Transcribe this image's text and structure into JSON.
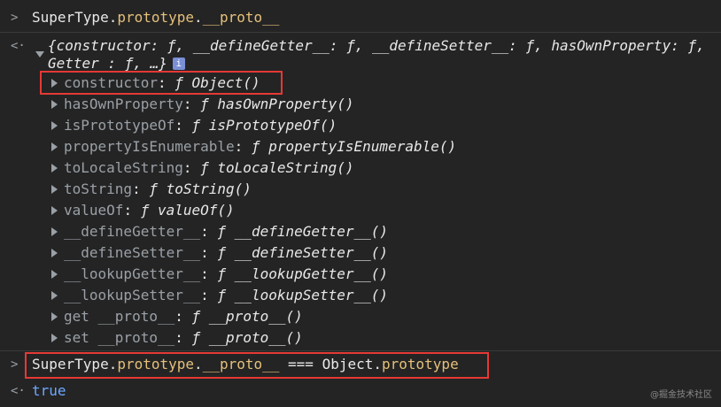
{
  "console": {
    "command1": {
      "obj": "SuperType",
      "dot1": ".",
      "prop1": "prototype",
      "dot2": ".",
      "prop2": "__proto__"
    },
    "result_summary_line1": "{constructor: ƒ, __defineGetter__: ƒ, __defineSetter__: ƒ, hasOwnProperty: ƒ,",
    "result_summary_line2": "Getter  : ƒ, …}",
    "info_badge": "i",
    "properties": [
      {
        "key": "constructor",
        "sep": ": ",
        "f": "ƒ",
        "fn": "Object()"
      },
      {
        "key": "hasOwnProperty",
        "sep": ": ",
        "f": "ƒ",
        "fn": "hasOwnProperty()"
      },
      {
        "key": "isPrototypeOf",
        "sep": ": ",
        "f": "ƒ",
        "fn": "isPrototypeOf()"
      },
      {
        "key": "propertyIsEnumerable",
        "sep": ": ",
        "f": "ƒ",
        "fn": "propertyIsEnumerable()"
      },
      {
        "key": "toLocaleString",
        "sep": ": ",
        "f": "ƒ",
        "fn": "toLocaleString()"
      },
      {
        "key": "toString",
        "sep": ": ",
        "f": "ƒ",
        "fn": "toString()"
      },
      {
        "key": "valueOf",
        "sep": ": ",
        "f": "ƒ",
        "fn": "valueOf()"
      },
      {
        "key": "__defineGetter__",
        "sep": ": ",
        "f": "ƒ",
        "fn": "__defineGetter__()"
      },
      {
        "key": "__defineSetter__",
        "sep": ": ",
        "f": "ƒ",
        "fn": "__defineSetter__()"
      },
      {
        "key": "__lookupGetter__",
        "sep": ": ",
        "f": "ƒ",
        "fn": "__lookupGetter__()"
      },
      {
        "key": "__lookupSetter__",
        "sep": ": ",
        "f": "ƒ",
        "fn": "__lookupSetter__()"
      },
      {
        "key": "get __proto__",
        "sep": ": ",
        "f": "ƒ",
        "fn": "__proto__()"
      },
      {
        "key": "set __proto__",
        "sep": ": ",
        "f": "ƒ",
        "fn": "__proto__()"
      }
    ],
    "command2": {
      "obj": "SuperType",
      "dot1": ".",
      "prop1": "prototype",
      "dot2": ".",
      "prop2": "__proto__",
      "op": " === ",
      "obj2": "Object",
      "dot3": ".",
      "prop3": "prototype"
    },
    "result2": "true",
    "prompt_symbol": ">",
    "result_symbol": "<·"
  },
  "watermark": "@掘金技术社区",
  "colors": {
    "background": "#242424",
    "highlight_box": "#e53935",
    "string_yellow": "#e5c07b",
    "boolean_blue": "#6ea8ff"
  }
}
